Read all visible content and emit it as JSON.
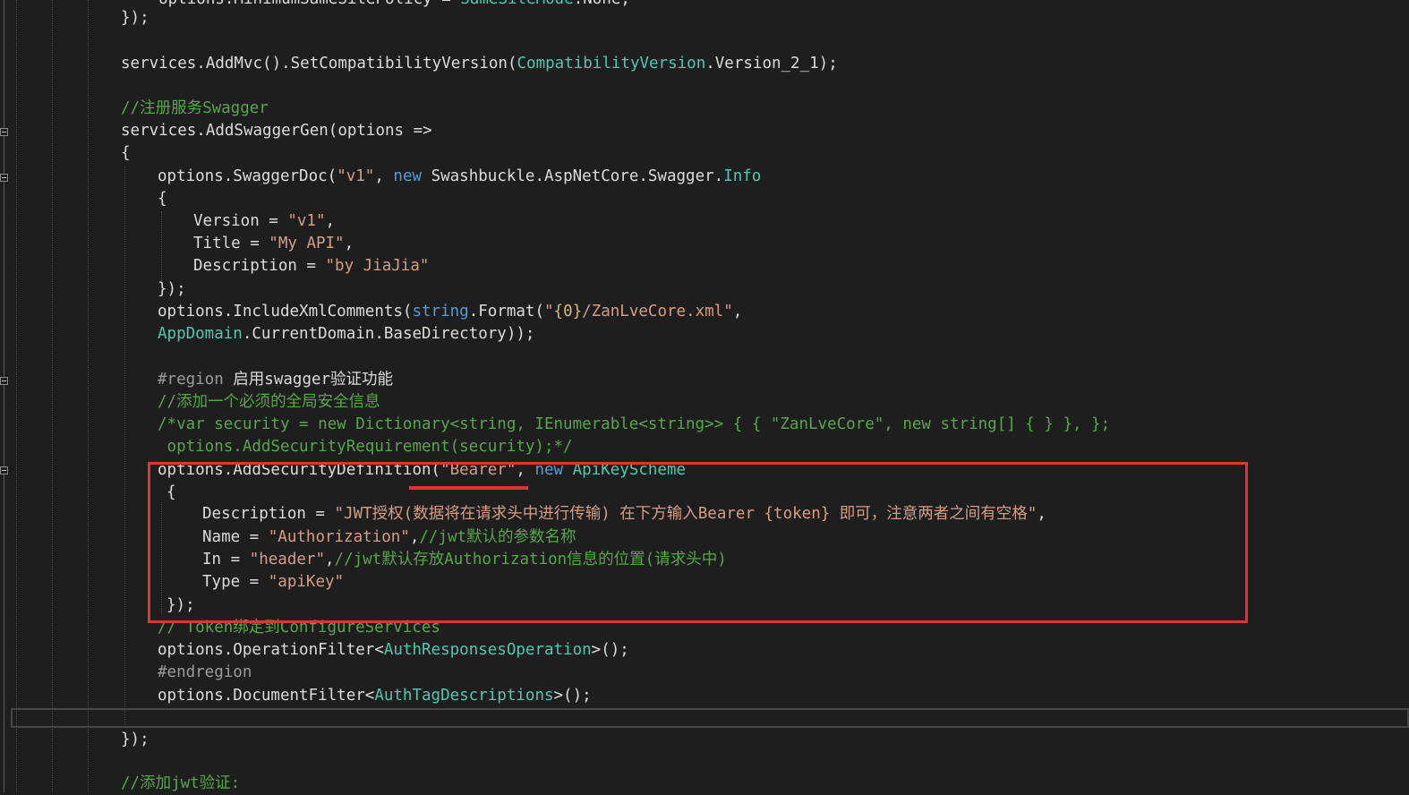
{
  "editor": {
    "lines": [
      {
        "id": "l0",
        "tokens": [
          [
            "plain",
            "    options.MinimumSameSitePolicy = "
          ],
          [
            "type",
            "SameSiteMode"
          ],
          [
            "plain",
            ".None;"
          ]
        ]
      },
      {
        "id": "l1",
        "tokens": [
          [
            "plain",
            "});"
          ]
        ]
      },
      {
        "id": "l2",
        "tokens": [
          [
            "plain",
            "services.AddMvc().SetCompatibilityVersion("
          ],
          [
            "type",
            "CompatibilityVersion"
          ],
          [
            "plain",
            ".Version_2_1);"
          ]
        ]
      },
      {
        "id": "l3",
        "tokens": [
          [
            "cmt",
            "//注册服务Swagger"
          ]
        ]
      },
      {
        "id": "l4",
        "tokens": [
          [
            "plain",
            "services.AddSwaggerGen(options =>"
          ]
        ]
      },
      {
        "id": "l5",
        "tokens": [
          [
            "plain",
            "{"
          ]
        ]
      },
      {
        "id": "l6",
        "tokens": [
          [
            "plain",
            "options.SwaggerDoc("
          ],
          [
            "str",
            "\"v1\""
          ],
          [
            "plain",
            ", "
          ],
          [
            "kw",
            "new"
          ],
          [
            "plain",
            " Swashbuckle.AspNetCore.Swagger."
          ],
          [
            "type",
            "Info"
          ]
        ]
      },
      {
        "id": "l7",
        "tokens": [
          [
            "plain",
            "{"
          ]
        ]
      },
      {
        "id": "l8",
        "tokens": [
          [
            "plain",
            "Version = "
          ],
          [
            "str",
            "\"v1\""
          ],
          [
            "plain",
            ","
          ]
        ]
      },
      {
        "id": "l9",
        "tokens": [
          [
            "plain",
            "Title = "
          ],
          [
            "str",
            "\"My API\""
          ],
          [
            "plain",
            ","
          ]
        ]
      },
      {
        "id": "l10",
        "tokens": [
          [
            "plain",
            "Description = "
          ],
          [
            "str",
            "\"by JiaJia\""
          ]
        ]
      },
      {
        "id": "l11",
        "tokens": [
          [
            "plain",
            "});"
          ]
        ]
      },
      {
        "id": "l12",
        "tokens": [
          [
            "plain",
            "options.IncludeXmlComments("
          ],
          [
            "kw",
            "string"
          ],
          [
            "plain",
            ".Format("
          ],
          [
            "str",
            "\""
          ],
          [
            "fmt",
            "{0}"
          ],
          [
            "str",
            "/ZanLveCore.xml\""
          ],
          [
            "plain",
            ","
          ]
        ]
      },
      {
        "id": "l13",
        "tokens": [
          [
            "type",
            "AppDomain"
          ],
          [
            "plain",
            ".CurrentDomain.BaseDirectory));"
          ]
        ]
      },
      {
        "id": "l14",
        "tokens": [
          [
            "pre",
            "#region "
          ],
          [
            "plain",
            "启用swagger验证功能"
          ]
        ]
      },
      {
        "id": "l15",
        "tokens": [
          [
            "cmt",
            "//添加一个必须的全局安全信息"
          ]
        ]
      },
      {
        "id": "l16",
        "tokens": [
          [
            "cmt",
            "/*var security = new Dictionary<string, IEnumerable<string>> { { \"ZanLveCore\", new string[] { } }, };"
          ]
        ]
      },
      {
        "id": "l17",
        "tokens": [
          [
            "cmt",
            " options.AddSecurityRequirement(security);*/"
          ]
        ]
      },
      {
        "id": "l18",
        "tokens": [
          [
            "plain",
            "options.AddSecurityDefinition("
          ],
          [
            "str",
            "\"Bearer\""
          ],
          [
            "plain",
            ", "
          ],
          [
            "kw",
            "new"
          ],
          [
            "plain",
            " "
          ],
          [
            "type",
            "ApiKeyScheme"
          ]
        ]
      },
      {
        "id": "l19",
        "tokens": [
          [
            "plain",
            "{"
          ]
        ]
      },
      {
        "id": "l20",
        "tokens": [
          [
            "plain",
            "Description = "
          ],
          [
            "str",
            "\"JWT授权(数据将在请求头中进行传输) 在下方输入Bearer {token} 即可，注意两者之间有空格\""
          ],
          [
            "plain",
            ","
          ]
        ]
      },
      {
        "id": "l21",
        "tokens": [
          [
            "plain",
            "Name = "
          ],
          [
            "str",
            "\"Authorization\""
          ],
          [
            "plain",
            ","
          ],
          [
            "cmt",
            "//jwt默认的参数名称"
          ]
        ]
      },
      {
        "id": "l22",
        "tokens": [
          [
            "plain",
            "In = "
          ],
          [
            "str",
            "\"header\""
          ],
          [
            "plain",
            ","
          ],
          [
            "cmt",
            "//jwt默认存放Authorization信息的位置(请求头中)"
          ]
        ]
      },
      {
        "id": "l23",
        "tokens": [
          [
            "plain",
            "Type = "
          ],
          [
            "str",
            "\"apiKey\""
          ]
        ]
      },
      {
        "id": "l24",
        "tokens": [
          [
            "plain",
            "});"
          ]
        ]
      },
      {
        "id": "l25",
        "tokens": [
          [
            "cmt",
            "// Token绑定到ConfigureServices"
          ]
        ]
      },
      {
        "id": "l26",
        "tokens": [
          [
            "plain",
            "options.OperationFilter<"
          ],
          [
            "type",
            "AuthResponsesOperation"
          ],
          [
            "plain",
            ">();"
          ]
        ]
      },
      {
        "id": "l27",
        "tokens": [
          [
            "pre",
            "#endregion"
          ]
        ]
      },
      {
        "id": "l28",
        "tokens": [
          [
            "plain",
            "options.DocumentFilter<"
          ],
          [
            "type",
            "AuthTagDescriptions"
          ],
          [
            "plain",
            ">();"
          ]
        ]
      },
      {
        "id": "l29",
        "tokens": [
          [
            "plain",
            "});"
          ]
        ]
      },
      {
        "id": "l30",
        "tokens": [
          [
            "cmt",
            "//添加jwt验证:"
          ]
        ]
      }
    ]
  }
}
